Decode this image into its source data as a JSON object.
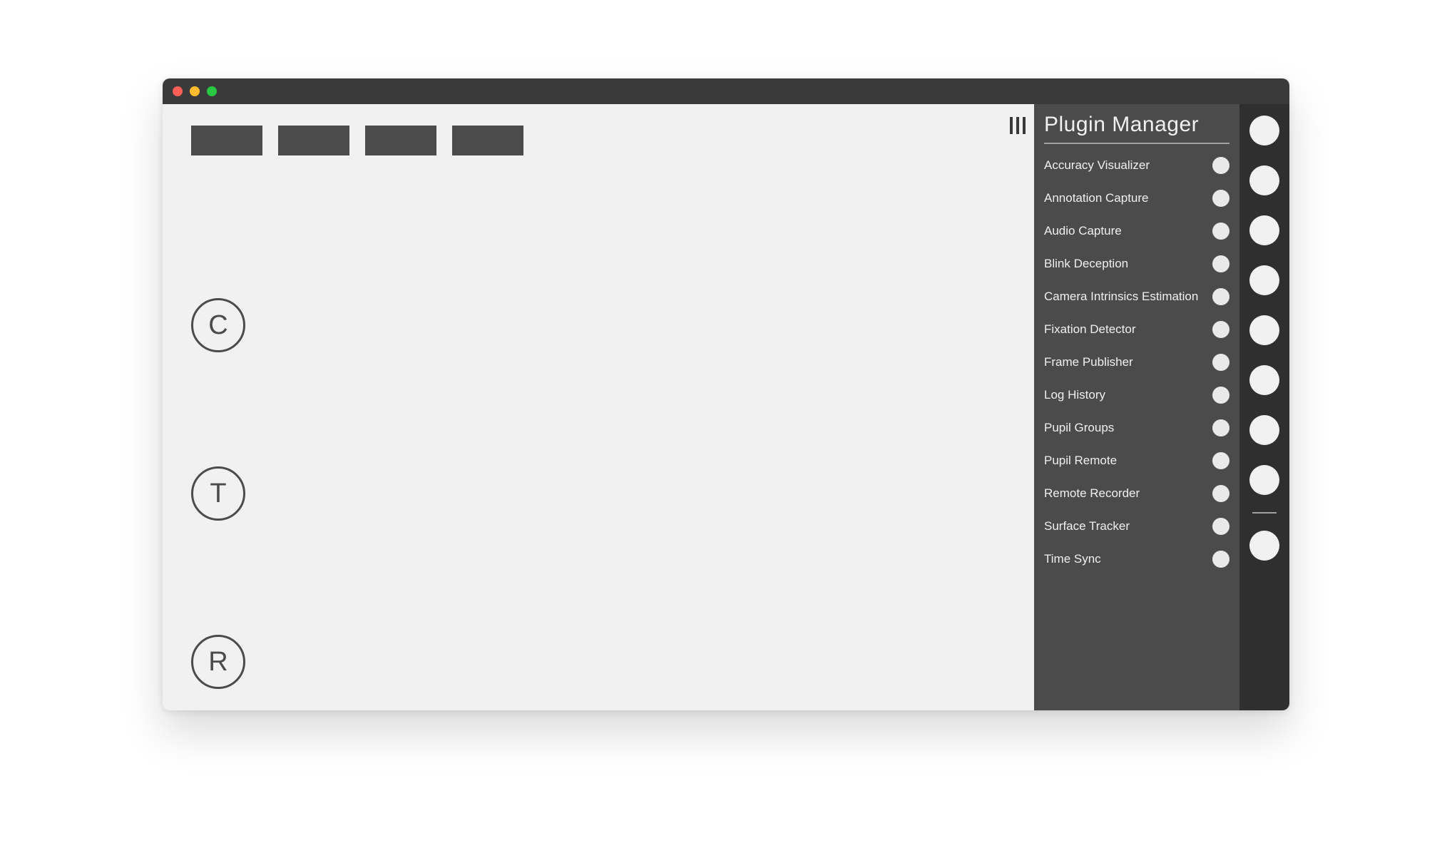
{
  "panel": {
    "title": "Plugin Manager",
    "plugins": [
      "Accuracy Visualizer",
      "Annotation Capture",
      "Audio Capture",
      "Blink Deception",
      "Camera Intrinsics Estimation",
      "Fixation Detector",
      "Frame Publisher",
      "Log History",
      "Pupil Groups",
      "Pupil Remote",
      "Remote Recorder",
      "Surface Tracker",
      "Time Sync"
    ]
  },
  "main": {
    "circle_buttons": [
      "C",
      "T",
      "R"
    ]
  },
  "iconbar": {
    "count_before_sep": 8,
    "count_after_sep": 1
  }
}
